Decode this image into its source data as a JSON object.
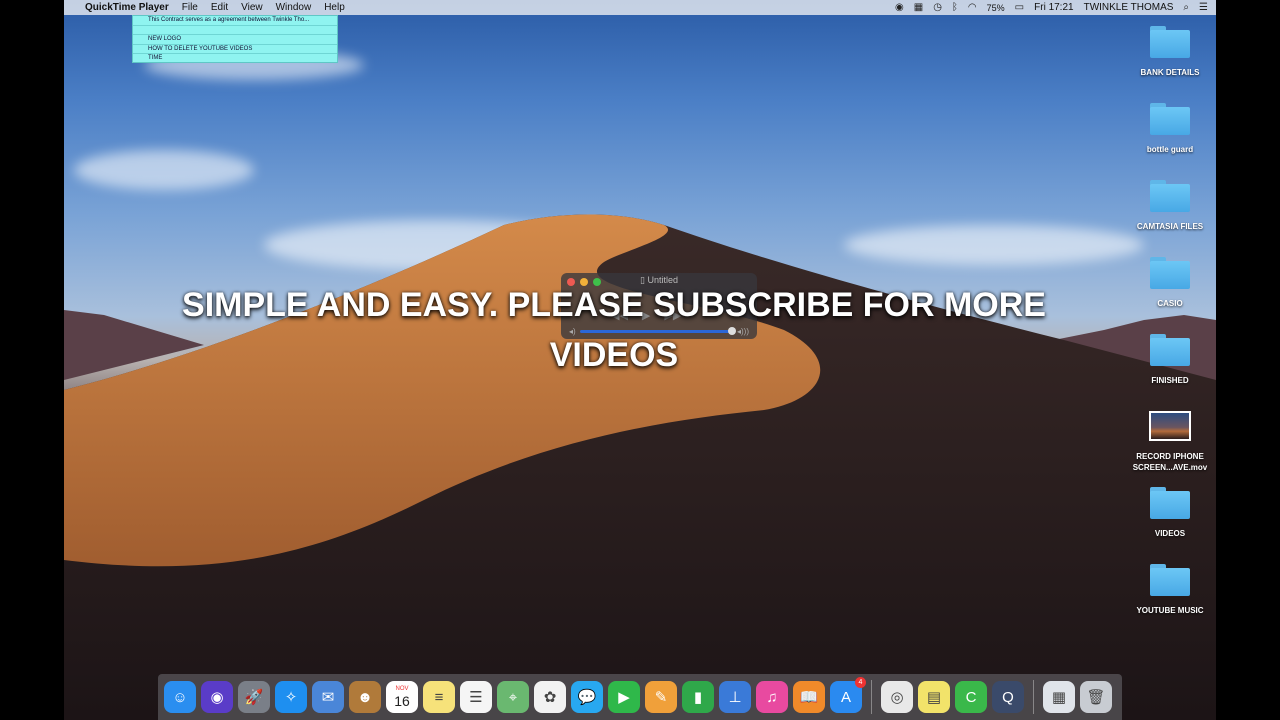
{
  "menubar": {
    "app_name": "QuickTime Player",
    "menus": [
      "File",
      "Edit",
      "View",
      "Window",
      "Help"
    ],
    "battery": "75%",
    "clock": "Fri 17:21",
    "user": "TWINKLE THOMAS"
  },
  "stickies": {
    "lines": [
      "This Contract serves as a agreement between Twinkle Tho...",
      "",
      "NEW LOGO",
      "HOW TO DELETE YOUTUBE VIDEOS",
      "TIME"
    ]
  },
  "desktop_icons": [
    {
      "label": "BANK DETAILS",
      "kind": "folder"
    },
    {
      "label": "bottle guard",
      "kind": "folder"
    },
    {
      "label": "CAMTASIA FILES",
      "kind": "folder"
    },
    {
      "label": "CASIO",
      "kind": "folder"
    },
    {
      "label": "FINISHED",
      "kind": "folder"
    },
    {
      "label": "RECORD IPHONE SCREEN...AVE.mov",
      "kind": "movie"
    },
    {
      "label": "VIDEOS",
      "kind": "folder"
    },
    {
      "label": "YOUTUBE MUSIC",
      "kind": "folder"
    }
  ],
  "quicktime_window": {
    "title": "Untitled"
  },
  "caption": {
    "text": "SIMPLE AND EASY. PLEASE SUBSCRIBE FOR MORE VIDEOS"
  },
  "dock": {
    "calendar_month": "NOV",
    "calendar_day": "16",
    "appstore_badge": "4",
    "items": [
      {
        "name": "finder-icon",
        "glyph": "☺",
        "bg": "#2a8ef0"
      },
      {
        "name": "siri-icon",
        "glyph": "◉",
        "bg": "#5a3cc8"
      },
      {
        "name": "launchpad-icon",
        "glyph": "🚀",
        "bg": "#7a7f88"
      },
      {
        "name": "safari-icon",
        "glyph": "✧",
        "bg": "#1e8ff0"
      },
      {
        "name": "mail-icon",
        "glyph": "✉",
        "bg": "#4a86d8"
      },
      {
        "name": "contacts-icon",
        "glyph": "☻",
        "bg": "#b07a3a"
      },
      {
        "name": "calendar-icon",
        "glyph": "",
        "bg": "#ffffff"
      },
      {
        "name": "notes-icon",
        "glyph": "≡",
        "bg": "#f6e27a"
      },
      {
        "name": "reminders-icon",
        "glyph": "☰",
        "bg": "#f5f5f5"
      },
      {
        "name": "maps-icon",
        "glyph": "⌖",
        "bg": "#6ab870"
      },
      {
        "name": "photos-icon",
        "glyph": "✿",
        "bg": "#f2f2f2"
      },
      {
        "name": "messages-icon",
        "glyph": "💬",
        "bg": "#28a8f0"
      },
      {
        "name": "facetime-icon",
        "glyph": "▶",
        "bg": "#2fb84a"
      },
      {
        "name": "pages-icon",
        "glyph": "✎",
        "bg": "#f0a03a"
      },
      {
        "name": "numbers-icon",
        "glyph": "▮",
        "bg": "#2fa84a"
      },
      {
        "name": "keynote-icon",
        "glyph": "⊥",
        "bg": "#3a7ad8"
      },
      {
        "name": "itunes-icon",
        "glyph": "♫",
        "bg": "#e84aa0"
      },
      {
        "name": "books-icon",
        "glyph": "📖",
        "bg": "#f08a2a"
      },
      {
        "name": "app-store-icon",
        "glyph": "A",
        "bg": "#2a8af0"
      },
      {
        "name": "chrome-icon",
        "glyph": "◎",
        "bg": "#e8e8e8"
      },
      {
        "name": "stickies-icon",
        "glyph": "▤",
        "bg": "#f2e36a"
      },
      {
        "name": "camtasia-icon",
        "glyph": "C",
        "bg": "#3ab84a"
      },
      {
        "name": "quicktime-icon",
        "glyph": "Q",
        "bg": "#3a4a6a"
      },
      {
        "name": "downloads-stack-icon",
        "glyph": "▦",
        "bg": "#e0e4ea"
      },
      {
        "name": "trash-icon",
        "glyph": "🗑",
        "bg": "#c8ccd2"
      }
    ]
  }
}
